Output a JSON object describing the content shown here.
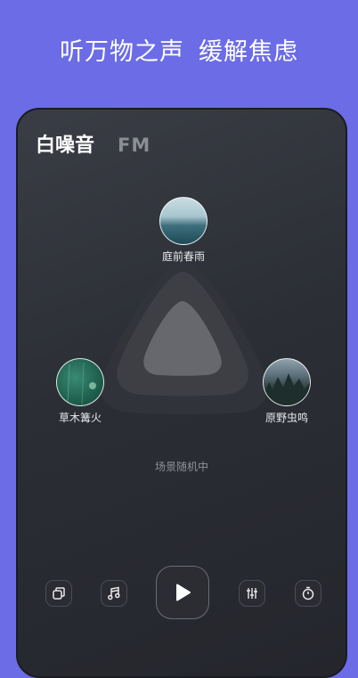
{
  "headline": {
    "part1": "听万物之声",
    "part2": "缓解焦虑"
  },
  "tabs": [
    {
      "label": "白噪音",
      "active": true
    },
    {
      "label": "FM",
      "active": false
    }
  ],
  "scenes": [
    {
      "label": "庭前春雨",
      "icon": "rain-scene-image"
    },
    {
      "label": "草木篝火",
      "icon": "campfire-scene-image"
    },
    {
      "label": "原野虫鸣",
      "icon": "forest-scene-image"
    }
  ],
  "status": "场景随机中",
  "controls": [
    {
      "icon": "scenes-copy-icon"
    },
    {
      "icon": "music-note-icon"
    },
    {
      "icon": "play-icon"
    },
    {
      "icon": "equalizer-icon"
    },
    {
      "icon": "timer-icon"
    }
  ],
  "colors": {
    "background": "#6b6ce6",
    "panel": "#2b2e35",
    "text": "#ffffff"
  }
}
